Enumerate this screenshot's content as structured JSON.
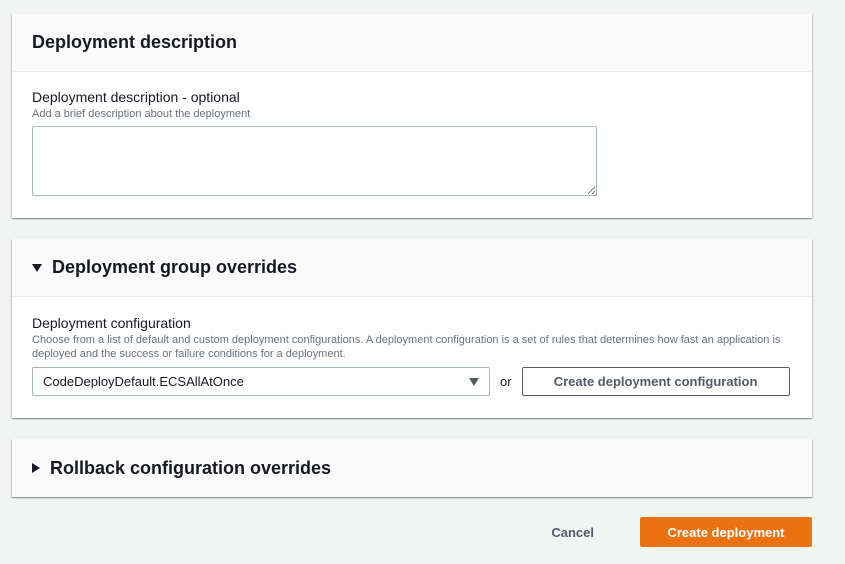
{
  "description_panel": {
    "title": "Deployment description",
    "field_label": "Deployment description - optional",
    "field_hint": "Add a brief description about the deployment",
    "value": ""
  },
  "overrides_panel": {
    "title": "Deployment group overrides",
    "expanded": true,
    "config_label": "Deployment configuration",
    "config_hint": "Choose from a list of default and custom deployment configurations. A deployment configuration is a set of rules that determines how fast an application is deployed and the success or failure conditions for a deployment.",
    "config_selected": "CodeDeployDefault.ECSAllAtOnce",
    "or_text": "or",
    "create_config_button": "Create deployment configuration"
  },
  "rollback_panel": {
    "title": "Rollback configuration overrides",
    "expanded": false
  },
  "footer": {
    "cancel_label": "Cancel",
    "create_label": "Create deployment"
  },
  "colors": {
    "primary": "#ec7211",
    "background": "#f2f3f3"
  }
}
